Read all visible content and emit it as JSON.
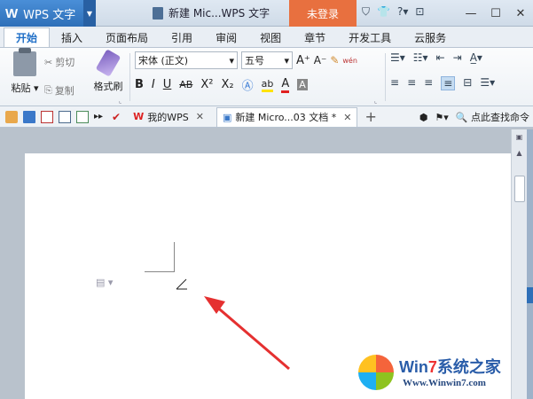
{
  "titlebar": {
    "logo": "W",
    "app_name": "WPS 文字",
    "doc_title": "新建 Mic...WPS 文字",
    "login_label": "未登录",
    "icons": [
      "shield-icon",
      "shirt-icon",
      "help-icon",
      "restore-icon"
    ],
    "help_text": "?",
    "window_controls": [
      "minimize",
      "maximize",
      "close"
    ]
  },
  "menu": {
    "tabs": [
      "开始",
      "插入",
      "页面布局",
      "引用",
      "审阅",
      "视图",
      "章节",
      "开发工具",
      "云服务"
    ],
    "active": "开始"
  },
  "ribbon": {
    "paste_label": "粘贴",
    "cut_label": "剪切",
    "copy_label": "复制",
    "format_painter_label": "格式刷",
    "font_name": "宋体 (正文)",
    "font_size": "五号",
    "bold": "B",
    "italic": "I",
    "underline": "U",
    "strike": "AB",
    "superscript": "X²",
    "subscript": "X₂",
    "grow": "A⁺",
    "shrink": "A⁻",
    "font_color": "A",
    "highlight": "ab",
    "phonetic": "wén"
  },
  "quickbar": {
    "doc_tabs": [
      {
        "label": "我的WPS",
        "active": false
      },
      {
        "label": "新建 Micro...03 文档 *",
        "active": true
      }
    ],
    "add_tab": "+",
    "search_label": "点此查找命令"
  },
  "watermark": {
    "brand_prefix": "Win",
    "brand_seven": "7",
    "brand_suffix": "系统之家",
    "url": "Www.Winwin7.com"
  },
  "colors": {
    "accent": "#2e6fb8",
    "login": "#e8703f",
    "arrow": "#e53030"
  }
}
